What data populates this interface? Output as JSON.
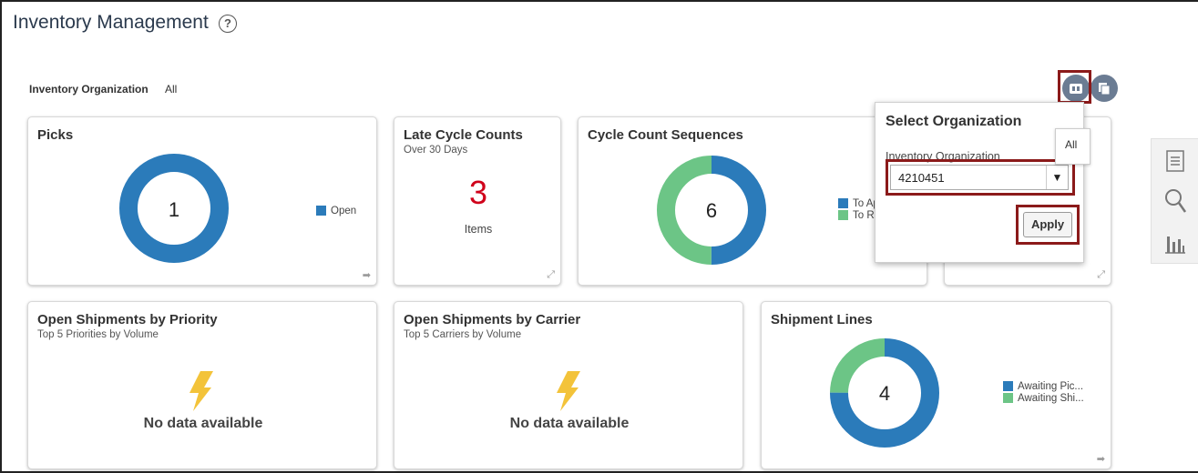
{
  "page": {
    "title": "Inventory Management",
    "help_icon": "question-circle-icon"
  },
  "filter": {
    "label": "Inventory Organization",
    "value": "All"
  },
  "colors": {
    "blue": "#2b7bba",
    "green": "#6cc586",
    "red": "#d0021b",
    "highlight": "#8b1a1a",
    "lightning": "#f3c33a"
  },
  "tiles": {
    "picks": {
      "title": "Picks",
      "center_value": "1",
      "legend": [
        {
          "label": "Open",
          "color": "#2b7bba"
        }
      ],
      "values": [
        1
      ]
    },
    "late_cycle_counts": {
      "title": "Late Cycle Counts",
      "subtitle": "Over 30 Days",
      "value": "3",
      "unit": "Items"
    },
    "cycle_count_sequences": {
      "title": "Cycle Count Sequences",
      "center_value": "6",
      "legend": [
        {
          "label": "To Ap",
          "color": "#2b7bba"
        },
        {
          "label": "To R",
          "color": "#6cc586"
        }
      ],
      "values": [
        3,
        3
      ]
    },
    "open_shipments_priority": {
      "title": "Open Shipments by Priority",
      "subtitle": "Top 5 Priorities by Volume",
      "empty_text": "No data available"
    },
    "open_shipments_carrier": {
      "title": "Open Shipments by Carrier",
      "subtitle": "Top 5 Carriers by Volume",
      "empty_text": "No data available"
    },
    "shipment_lines": {
      "title": "Shipment Lines",
      "center_value": "4",
      "legend": [
        {
          "label": "Awaiting Pic...",
          "color": "#2b7bba"
        },
        {
          "label": "Awaiting Shi...",
          "color": "#6cc586"
        }
      ],
      "values": [
        3,
        1
      ]
    }
  },
  "popup": {
    "title": "Select Organization",
    "field_label": "Inventory Organization",
    "selected_value": "4210451",
    "apply_label": "Apply",
    "tooltip": "All"
  },
  "side_panel": {
    "items": [
      "list-icon",
      "search-icon",
      "bar-chart-icon"
    ]
  }
}
